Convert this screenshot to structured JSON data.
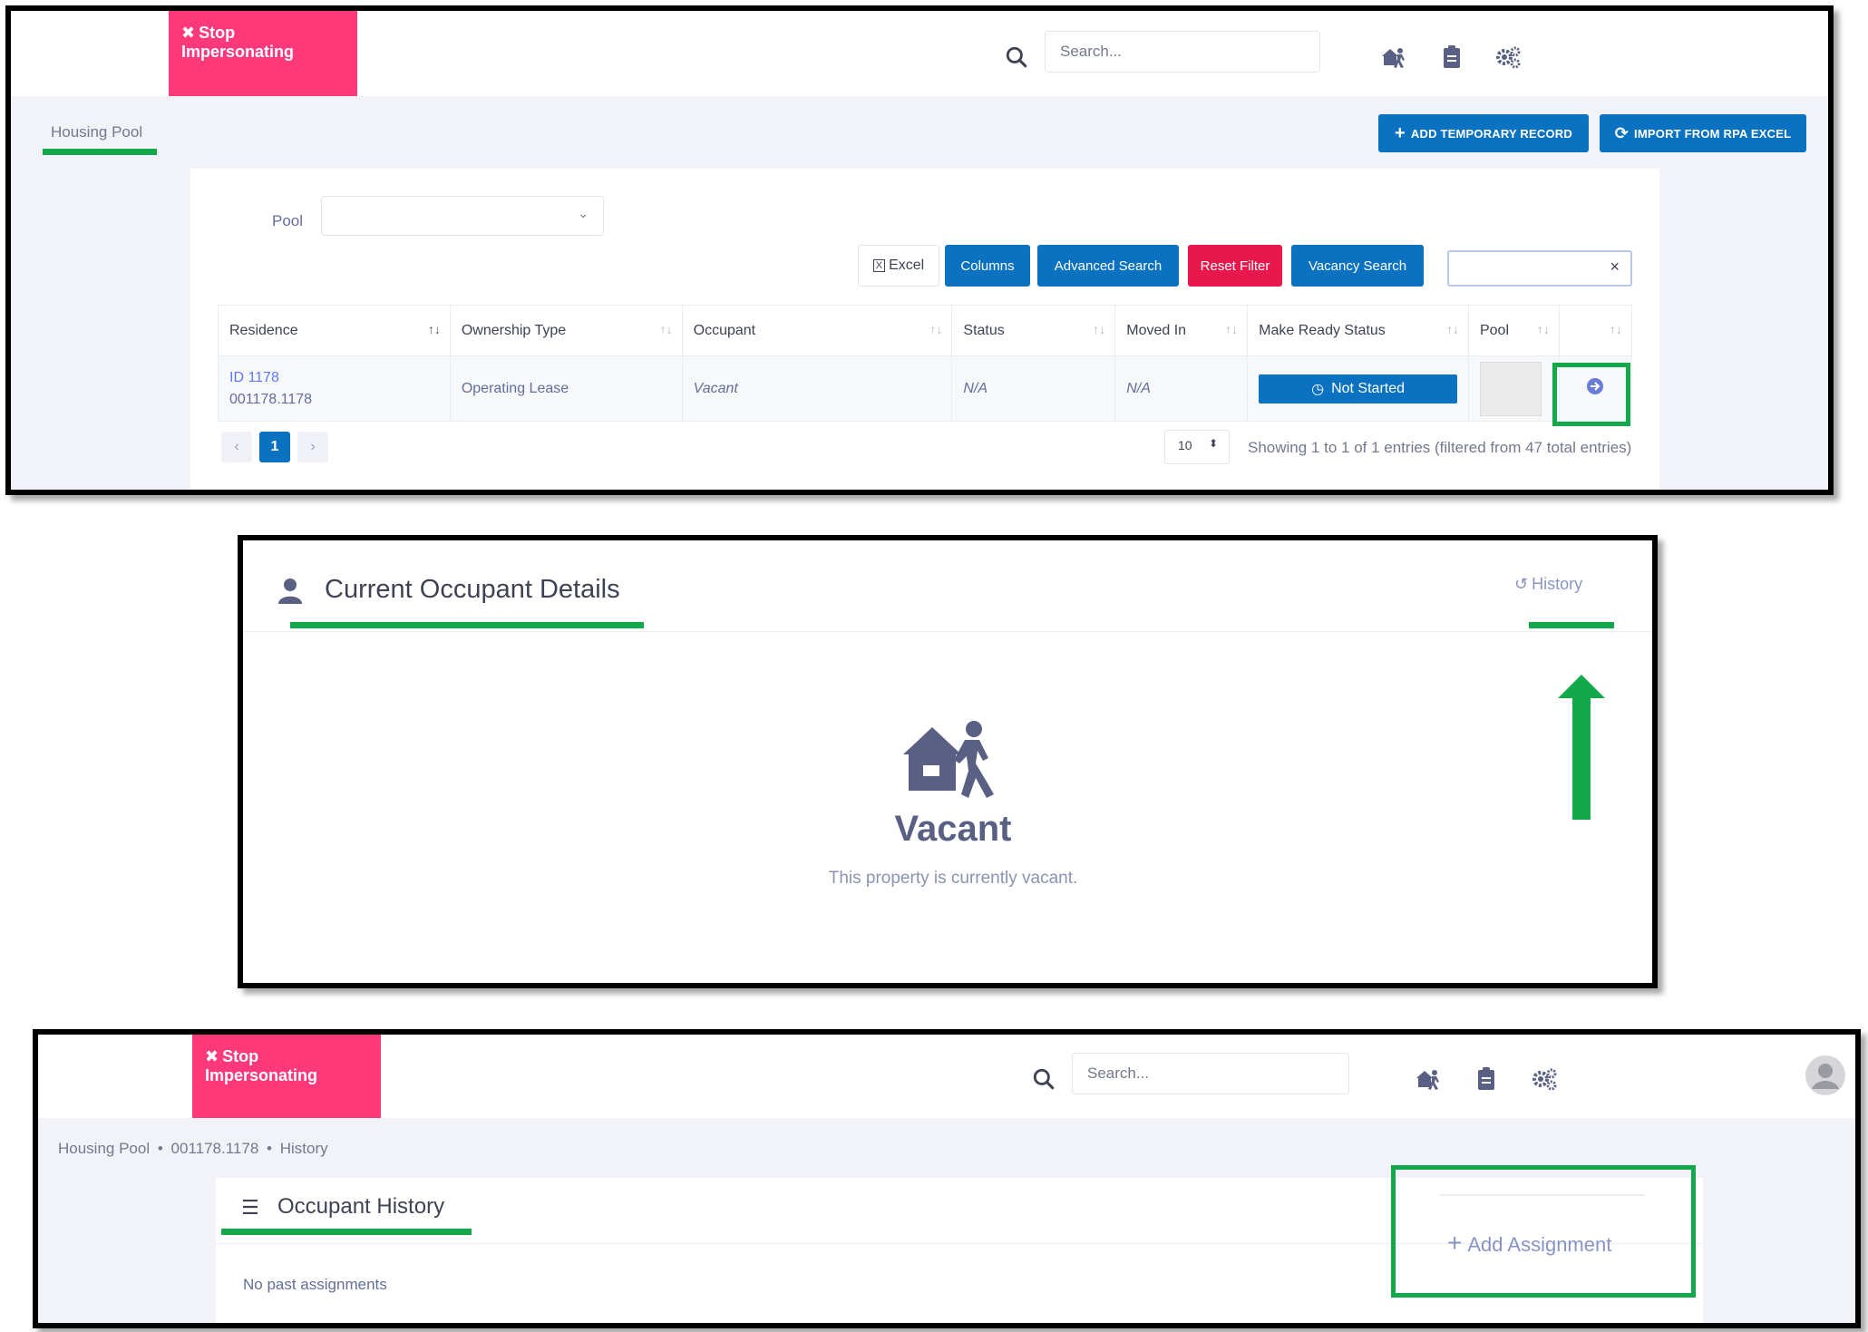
{
  "colors": {
    "brand_blue": "#0a72c0",
    "stop_pink": "#fd397a",
    "danger": "#e8184c",
    "highlight_green": "#13a84a",
    "icon_slate": "#5a6084"
  },
  "panel1": {
    "stop_impersonating": "Stop Impersonating",
    "search_placeholder": "Search...",
    "tab_housing_pool": "Housing Pool",
    "add_temporary_record": "ADD TEMPORARY RECORD",
    "import_from_rpa": "IMPORT FROM RPA EXCEL",
    "pool_label": "Pool",
    "pool_selected": "",
    "toolbar": {
      "excel": "Excel",
      "columns": "Columns",
      "advanced_search": "Advanced Search",
      "reset_filter": "Reset Filter",
      "vacancy_search": "Vacancy Search",
      "filter_clear": "×"
    },
    "table": {
      "headers": [
        "Residence",
        "Ownership Type",
        "Occupant",
        "Status",
        "Moved In",
        "Make Ready Status",
        "Pool",
        ""
      ],
      "rows": [
        {
          "residence_id": "ID 1178",
          "residence_code": "001178.1178",
          "ownership_type": "Operating Lease",
          "occupant": "Vacant",
          "status": "N/A",
          "moved_in": "N/A",
          "make_ready_status": "Not Started"
        }
      ]
    },
    "pagination": {
      "prev": "‹",
      "current": "1",
      "next": "›",
      "page_size": "10",
      "info": "Showing 1 to 1 of 1 entries (filtered from 47 total entries)"
    }
  },
  "panel2": {
    "title": "Current Occupant Details",
    "history_link": "History",
    "empty_title": "Vacant",
    "empty_text": "This property is currently vacant."
  },
  "panel3": {
    "stop_impersonating": "Stop Impersonating",
    "search_placeholder": "Search...",
    "breadcrumb": [
      "Housing Pool",
      "001178.1178",
      "History"
    ],
    "section_title": "Occupant History",
    "add_assignment": "Add Assignment",
    "empty_text": "No past assignments"
  }
}
